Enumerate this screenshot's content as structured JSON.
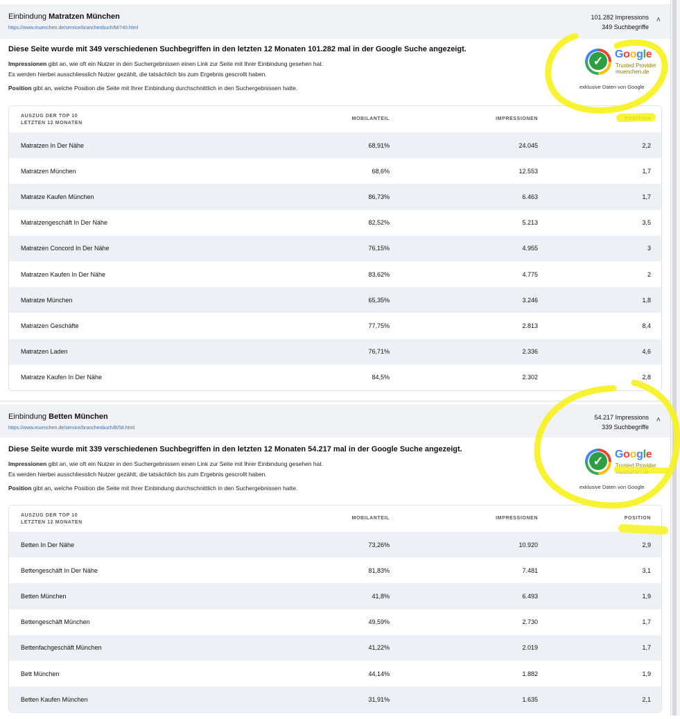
{
  "sections": [
    {
      "title_prefix": "Einbindung",
      "title_strong": "Matratzen München",
      "url": "https://www.muenchen.de/service/branchenbuch/M/740.html",
      "impressions": "101.282 Impressions",
      "queries": "349 Suchbegriffe",
      "headline": "Diese Seite wurde mit 349 verschiedenen Suchbegriffen in den letzten 12 Monaten 101.282 mal in der Google Suche angezeigt.",
      "desc_impr_term": "Impressionen",
      "desc_impr_text": " gibt an, wie oft ein Nutzer in den Suchergebnissen einen Link zur Seite mit Ihrer Einbindung gesehen hat.",
      "desc_users": "Es werden hierbei ausschliesslich Nutzer gezählt, die tatsächlich bis zum Ergebnis gescrollt haben.",
      "desc_pos_term": "Position",
      "desc_pos_text": " gibt an, welche Position die Seite mit Ihrer Einbindung durchschnittlich in den Suchergebnissen hatte.",
      "table_header": {
        "keyword_l1": "AUSZUG DER TOP 10",
        "keyword_l2": "LETZTEN 12 MONATEN",
        "mobile": "MOBILANTEIL",
        "impressions": "IMPRESSIONEN",
        "position": "POSITION"
      },
      "rows": [
        {
          "kw": "Matratzen In Der Nähe",
          "mob": "68,91%",
          "imp": "24.045",
          "pos": "2,2"
        },
        {
          "kw": "Matratzen München",
          "mob": "68,6%",
          "imp": "12.553",
          "pos": "1,7"
        },
        {
          "kw": "Matratze Kaufen München",
          "mob": "86,73%",
          "imp": "6.463",
          "pos": "1,7"
        },
        {
          "kw": "Matratzengeschäft In Der Nähe",
          "mob": "82,52%",
          "imp": "5.213",
          "pos": "3,5"
        },
        {
          "kw": "Matratzen Concord In Der Nähe",
          "mob": "76,15%",
          "imp": "4.955",
          "pos": "3"
        },
        {
          "kw": "Matratzen Kaufen In Der Nähe",
          "mob": "83,62%",
          "imp": "4.775",
          "pos": "2"
        },
        {
          "kw": "Matratze München",
          "mob": "65,35%",
          "imp": "3.246",
          "pos": "1,8"
        },
        {
          "kw": "Matratzen Geschäfte",
          "mob": "77,75%",
          "imp": "2.813",
          "pos": "8,4"
        },
        {
          "kw": "Matratzen Laden",
          "mob": "76,71%",
          "imp": "2.336",
          "pos": "4,6"
        },
        {
          "kw": "Matratze Kaufen In Der Nähe",
          "mob": "84,5%",
          "imp": "2.302",
          "pos": "2,8"
        }
      ]
    },
    {
      "title_prefix": "Einbindung",
      "title_strong": "Betten München",
      "url": "https://www.muenchen.de/service/branchenbuch/B/58.html",
      "impressions": "54.217 Impressions",
      "queries": "339 Suchbegriffe",
      "headline": "Diese Seite wurde mit 339 verschiedenen Suchbegriffen in den letzten 12 Monaten 54.217 mal in der Google Suche angezeigt.",
      "desc_impr_term": "Impressionen",
      "desc_impr_text": " gibt an, wie oft ein Nutzer in den Suchergebnissen einen Link zur Seite mit Ihrer Einbindung gesehen hat.",
      "desc_users": "Es werden hierbei ausschliesslich Nutzer gezählt, die tatsächlich bis zum Ergebnis gescrollt haben.",
      "desc_pos_term": "Position",
      "desc_pos_text": " gibt an, welche Position die Seite mit Ihrer Einbindung durchschnittlich in den Suchergebnissen hatte.",
      "table_header": {
        "keyword_l1": "AUSZUG DER TOP 10",
        "keyword_l2": "LETZTEN 12 MONATEN",
        "mobile": "MOBILANTEIL",
        "impressions": "IMPRESSIONEN",
        "position": "POSITION"
      },
      "rows": [
        {
          "kw": "Betten In Der Nähe",
          "mob": "73,26%",
          "imp": "10.920",
          "pos": "2,9"
        },
        {
          "kw": "Bettengeschäft In Der Nähe",
          "mob": "81,83%",
          "imp": "7.481",
          "pos": "3,1"
        },
        {
          "kw": "Betten München",
          "mob": "41,8%",
          "imp": "6.493",
          "pos": "1,9"
        },
        {
          "kw": "Bettengeschäft München",
          "mob": "49,59%",
          "imp": "2.730",
          "pos": "1,7"
        },
        {
          "kw": "Bettenfachgeschäft München",
          "mob": "41,22%",
          "imp": "2.019",
          "pos": "1,7"
        },
        {
          "kw": "Bett München",
          "mob": "44,14%",
          "imp": "1.882",
          "pos": "1,9"
        },
        {
          "kw": "Betten Kaufen München",
          "mob": "31,91%",
          "imp": "1.635",
          "pos": "2,1"
        }
      ]
    }
  ],
  "badge": {
    "word_g": "G",
    "word_o1": "o",
    "word_o2": "o",
    "word_g2": "g",
    "word_l": "l",
    "word_e": "e",
    "line1": "Trusted Provider",
    "line2": "muenchen.de",
    "caption": "exklusive Daten von Google",
    "check": "✓"
  },
  "ui": {
    "chevron": "˄"
  },
  "colors": {
    "highlight": "#f7f21c",
    "row_alt": "#edf0f4",
    "header_bg": "#f0f2f5",
    "link": "#3a6fb0"
  }
}
